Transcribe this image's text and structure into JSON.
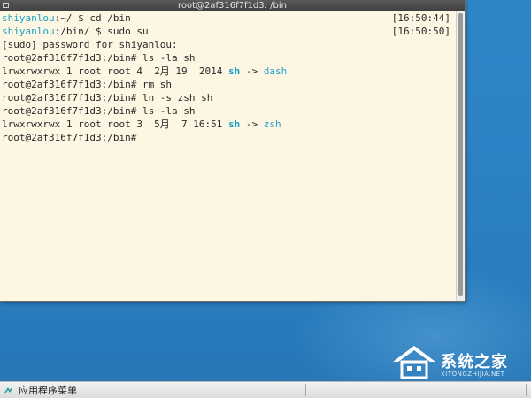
{
  "window": {
    "title": "root@2af316f7f1d3: /bin"
  },
  "terminal": {
    "lines": [
      {
        "user": "shiyanlou",
        "rest": ":~/ $ cd /bin",
        "timestamp": "[16:50:44]"
      },
      {
        "user": "shiyanlou",
        "rest": ":/bin/ $ sudo su",
        "timestamp": "[16:50:50]"
      },
      {
        "text": "[sudo] password for shiyanlou:"
      },
      {
        "text": "root@2af316f7f1d3:/bin# ls -la sh"
      },
      {
        "prefix": "lrwxrwxrwx 1 root root 4  2月 19  2014 ",
        "link": "sh",
        "arrow": " -> ",
        "target": "dash"
      },
      {
        "text": "root@2af316f7f1d3:/bin# rm sh"
      },
      {
        "text": "root@2af316f7f1d3:/bin# ln -s zsh sh"
      },
      {
        "text": "root@2af316f7f1d3:/bin# ls -la sh"
      },
      {
        "prefix": "lrwxrwxrwx 1 root root 3  5月  7 16:51 ",
        "link": "sh",
        "arrow": " -> ",
        "target": "zsh"
      },
      {
        "text": "root@2af316f7f1d3:/bin#"
      }
    ]
  },
  "taskbar": {
    "app_menu_label": "应用程序菜单",
    "app_menu_icon": "app-menu-icon"
  },
  "watermark": {
    "name": "系统之家",
    "url": "XITONGZHIJIA.NET"
  },
  "colors": {
    "terminal_bg": "#fcf6e3",
    "user_prompt": "#1aa3c7",
    "desktop_bg": "#2b80c2"
  }
}
